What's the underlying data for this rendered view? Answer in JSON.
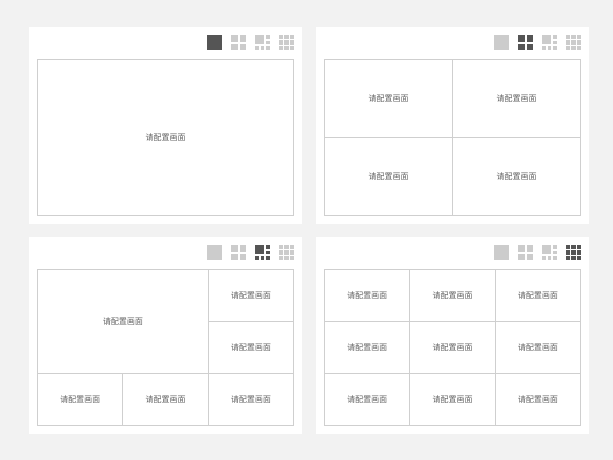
{
  "placeholder": "请配置画面",
  "icons": {
    "layout_1": "single-view-icon",
    "layout_4": "four-split-icon",
    "layout_6": "six-split-icon",
    "layout_9": "nine-split-icon"
  },
  "colors": {
    "background": "#f2f2f2",
    "panel": "#ffffff",
    "icon_inactive": "#cccccc",
    "icon_active": "#555555",
    "border": "#cfcfcf",
    "text": "#666666"
  },
  "panels": [
    {
      "layout": "1",
      "active_icon": "layout_1"
    },
    {
      "layout": "4",
      "active_icon": "layout_4"
    },
    {
      "layout": "6",
      "active_icon": "layout_6"
    },
    {
      "layout": "9",
      "active_icon": "layout_9"
    }
  ]
}
